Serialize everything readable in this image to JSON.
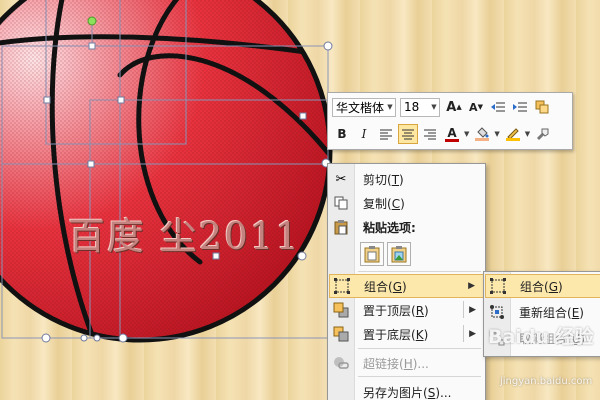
{
  "canvas": {
    "watermark_text": "百度 尘2011",
    "ball_color": "#e8333f",
    "seam_color": "#111111",
    "selection_color": "#8b95b7"
  },
  "toolbar": {
    "font_name": "华文楷体",
    "font_size": "18",
    "row1_icons": [
      "grow-font-icon",
      "shrink-font-icon",
      "decrease-indent-icon",
      "increase-indent-icon",
      "shape-styles-icon"
    ],
    "row2_buttons": {
      "bold": "B",
      "italic": "I",
      "align_left": "left-align-icon",
      "center": "center-align-icon",
      "align_right": "right-align-icon",
      "font_color": "A",
      "fill_color": "fill-bucket-icon",
      "outline_color": "outline-pen-icon",
      "format_painter": "format-painter-icon"
    },
    "font_color_hex": "#c00000",
    "fill_color_hex": "#f4b183",
    "outline_color_hex": "#ffc000"
  },
  "context_menu": {
    "cut": {
      "label": "剪切",
      "key": "T"
    },
    "copy": {
      "label": "复制",
      "key": "C"
    },
    "paste_options": {
      "label": "粘贴选项:"
    },
    "group": {
      "label": "组合",
      "key": "G"
    },
    "bring_to_front": {
      "label": "置于顶层",
      "key": "R"
    },
    "send_to_back": {
      "label": "置于底层",
      "key": "K"
    },
    "hyperlink": {
      "label": "超链接",
      "key": "H",
      "suffix": "..."
    },
    "save_as_picture": {
      "label": "另存为图片",
      "key": "S",
      "suffix": "..."
    }
  },
  "submenu": {
    "group": {
      "label": "组合",
      "key": "G"
    },
    "regroup": {
      "label": "重新组合",
      "key": "E"
    },
    "ungroup": {
      "label": "取消组合",
      "key": "U"
    }
  },
  "watermark": {
    "brand": "Baidu 经验",
    "url": "jingyan.baidu.com"
  }
}
